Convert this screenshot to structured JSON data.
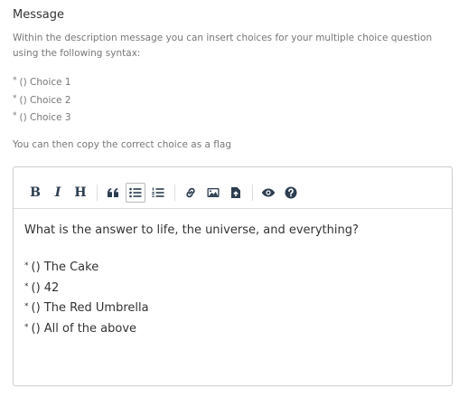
{
  "field": {
    "label": "Message",
    "help_intro": "Within the description message you can insert choices for your multiple choice question using the following syntax:",
    "syntax_examples": [
      "() Choice 1",
      "() Choice 2",
      "() Choice 3"
    ],
    "help_after": "You can then copy the correct choice as a flag"
  },
  "toolbar": {
    "bold": "B",
    "italic": "I",
    "heading": "H",
    "icons": [
      "bold-icon",
      "italic-icon",
      "heading-icon",
      "quote-icon",
      "unordered-list-icon",
      "ordered-list-icon",
      "link-icon",
      "image-icon",
      "upload-file-icon",
      "preview-icon",
      "help-icon"
    ],
    "active": "unordered-list"
  },
  "editor": {
    "question": "What is the answer to life, the universe, and everything?",
    "choices": [
      "() The Cake",
      "() 42",
      "() The Red Umbrella",
      "() All of the above"
    ]
  }
}
